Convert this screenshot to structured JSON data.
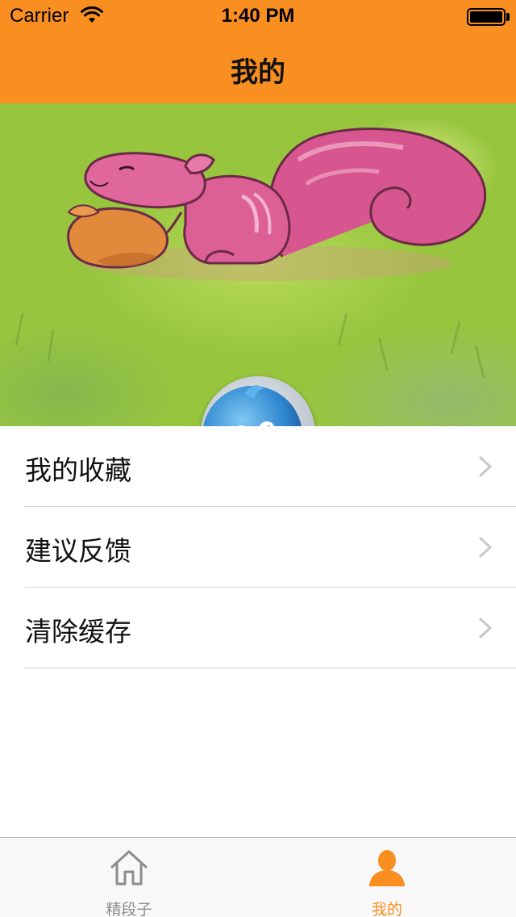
{
  "status_bar": {
    "carrier": "Carrier",
    "time": "1:40 PM"
  },
  "nav": {
    "title": "我的"
  },
  "profile": {
    "avatar_icon": "bird-avatar-icon",
    "background": "squirrel-illustration"
  },
  "menu": {
    "items": [
      {
        "label": "我的收藏",
        "icon": "chevron-right-icon"
      },
      {
        "label": "建议反馈",
        "icon": "chevron-right-icon"
      },
      {
        "label": "清除缓存",
        "icon": "chevron-right-icon"
      }
    ]
  },
  "tabbar": {
    "tabs": [
      {
        "label": "精段子",
        "icon": "home-icon",
        "selected": false
      },
      {
        "label": "我的",
        "icon": "person-icon",
        "selected": true
      }
    ]
  },
  "colors": {
    "accent": "#f98f20",
    "inactive": "#8c8c8c",
    "separator": "#d4d4d6"
  }
}
